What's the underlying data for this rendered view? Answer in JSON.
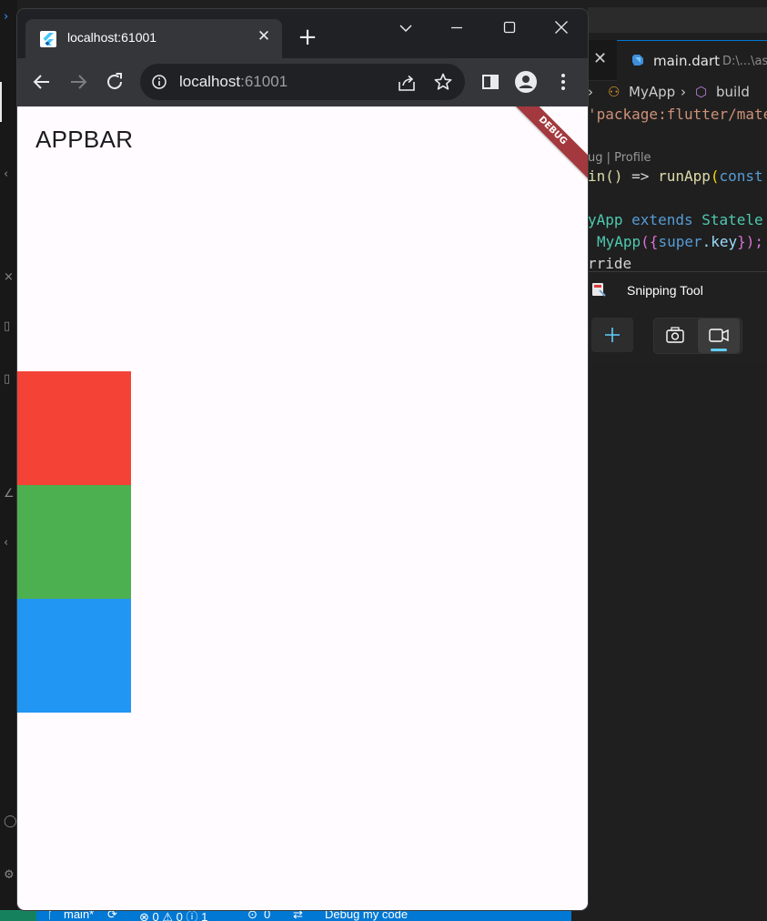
{
  "browser": {
    "tab_title": "localhost:61001",
    "tab_close": "✕",
    "new_tab": "+",
    "url_host": "localhost",
    "url_port": ":61001"
  },
  "flutter_app": {
    "appbar_title": "APPBAR",
    "debug_banner": "DEBUG",
    "boxes": [
      {
        "color": "#f44336"
      },
      {
        "color": "#4caf50"
      },
      {
        "color": "#2196f3"
      }
    ]
  },
  "vscode": {
    "tab_close": "✕",
    "file_tab": "main.dart",
    "file_path": "D:\\...\\as",
    "breadcrumb_class": "MyApp",
    "breadcrumb_method": "build",
    "codelens": "ug | Profile",
    "code": {
      "import_str": "'package:flutter/mate",
      "main_fn": "in()",
      "arrow": " => ",
      "run_app": "runApp",
      "paren_open": "(",
      "const_kw": "const",
      "class_name": "yApp",
      "extends_kw": " extends ",
      "stateless": "Statele",
      "ctor": "MyApp",
      "brace_open": "({",
      "super_kw": "super",
      "dot_key": ".key",
      "brace_close": "});",
      "override": "rride"
    },
    "status": {
      "branch": "main*",
      "problems": "⊗ 0 ⚠ 0 ⓘ 1",
      "ports": "0",
      "debug": "Debug my code"
    }
  },
  "snipping_tool": {
    "title": "Snipping Tool",
    "new_label": "+"
  }
}
